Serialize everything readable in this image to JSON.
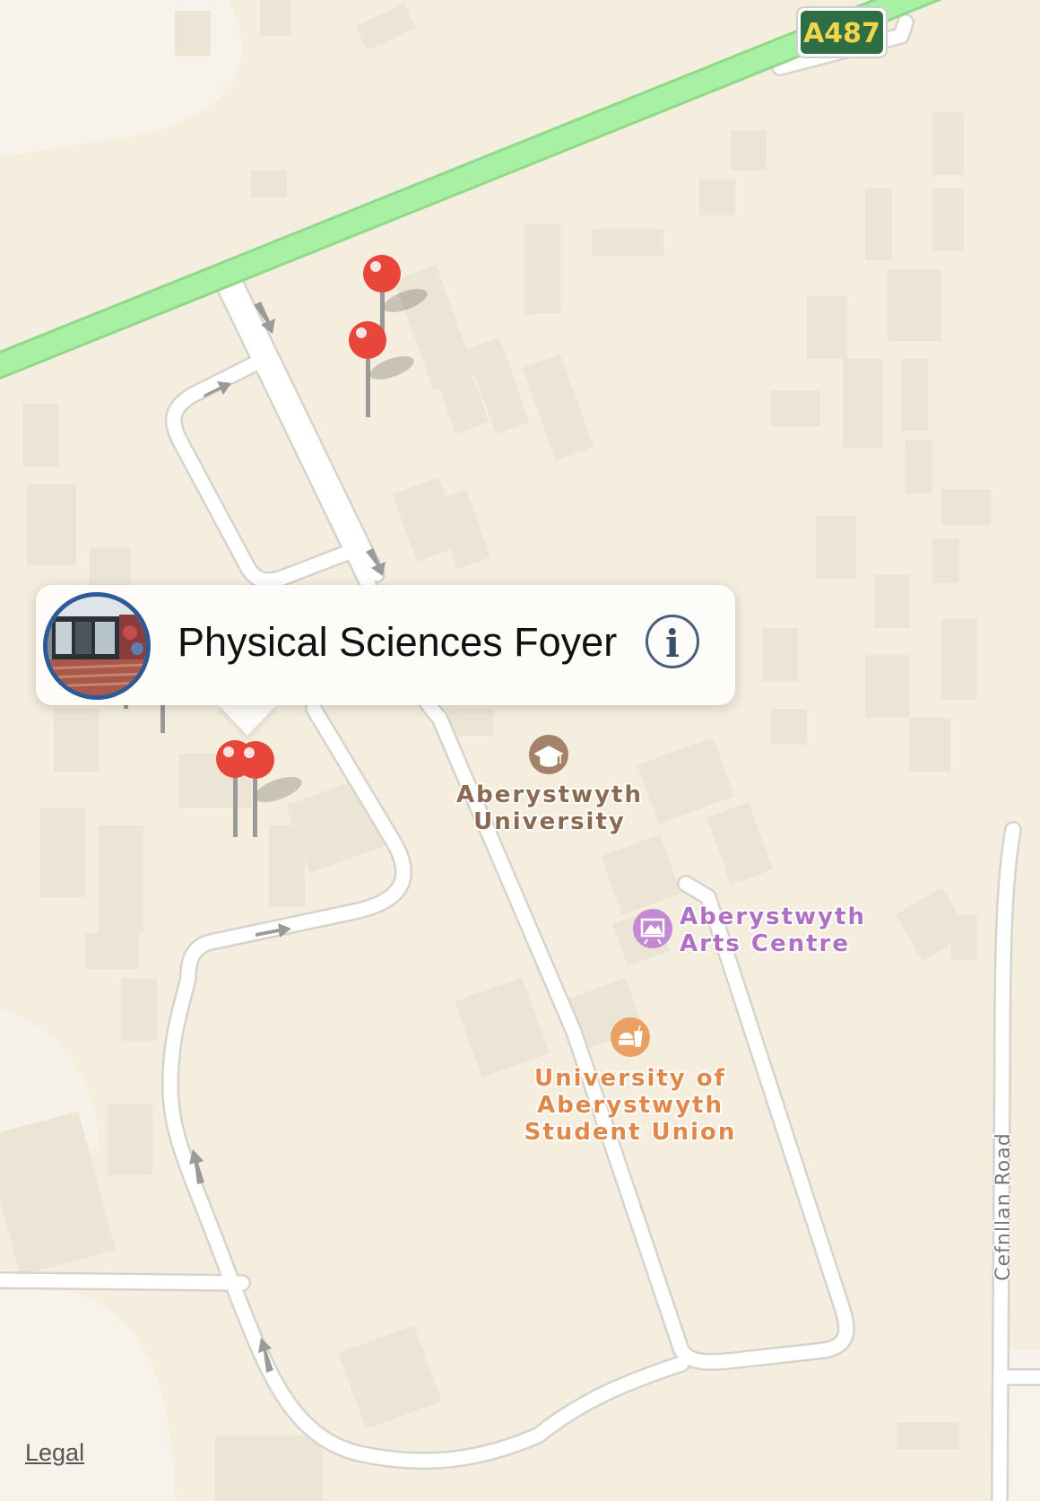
{
  "road_shield": {
    "label": "A487",
    "bg": "#2f6e45",
    "text_color": "#f3d54c"
  },
  "road_names": [
    {
      "label": "Cefnllan Road"
    }
  ],
  "pois": [
    {
      "lines": [
        "Aberystwyth",
        "University"
      ],
      "icon": "graduation-cap-icon",
      "color": "#8a6a50"
    },
    {
      "lines": [
        "Aberystwyth",
        "Arts Centre"
      ],
      "icon": "easel-icon",
      "color": "#b06fc4"
    },
    {
      "lines": [
        "University of",
        "Aberystwyth",
        "Student Union"
      ],
      "icon": "fast-food-icon",
      "color": "#e0884a"
    }
  ],
  "callout": {
    "title": "Physical Sciences Foyer",
    "info_icon": "info-icon"
  },
  "legal": "Legal",
  "colors": {
    "land": "#f6efe0",
    "building": "#ece6d9",
    "road": "#ffffff",
    "major_road": "#a5eea0",
    "pin": "#e8463a"
  }
}
